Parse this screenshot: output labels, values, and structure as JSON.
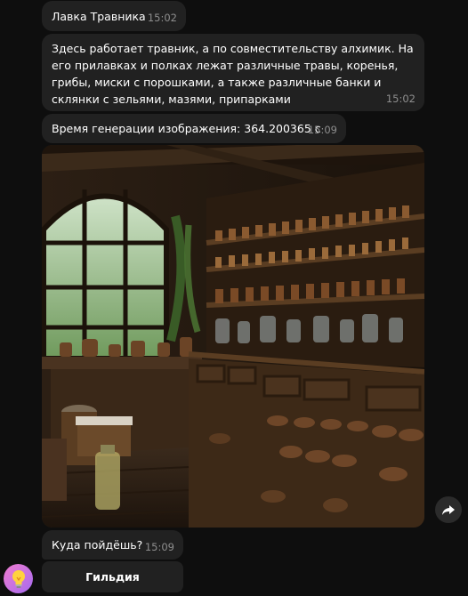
{
  "messages": [
    {
      "text": "Лавка Травника",
      "time": "15:02"
    },
    {
      "text": "Здесь работает травник, а по совместительству  алхимик. На его прилавках и полках лежат различные травы, коренья, грибы, миски с порошками, а также различные банки и склянки с зельями, мазями, припарками",
      "time": "15:02"
    },
    {
      "text": "Время генерации изображения: 364.200365 с",
      "time": "15:09"
    },
    {
      "text": "Куда пойдёшь?",
      "time": "15:09"
    }
  ],
  "keyboard": {
    "button_label": "Гильдия"
  },
  "image": {
    "subject": "herbalist shop interior with shelves of jars"
  },
  "icons": {
    "forward": "forward-arrow-icon",
    "avatar": "lightbulb-icon"
  },
  "colors": {
    "background": "#0e0e0e",
    "bubble": "#212121",
    "time": "#8e8e8e"
  }
}
